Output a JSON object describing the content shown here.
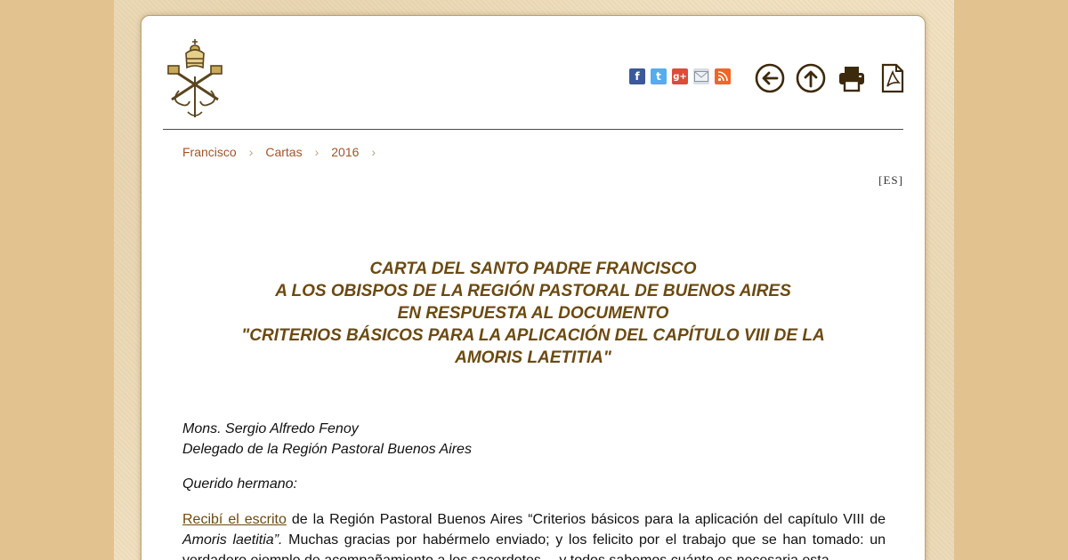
{
  "breadcrumb": [
    "Francisco",
    "Cartas",
    "2016"
  ],
  "language": "[ES]",
  "title_lines": [
    "CARTA DEL SANTO PADRE FRANCISCO",
    "A LOS OBISPOS DE LA REGIÓN PASTORAL DE BUENOS AIRES",
    "EN RESPUESTA AL DOCUMENTO",
    "\"CRITERIOS BÁSICOS PARA LA APLICACIÓN DEL CAPÍTULO VIII DE LA",
    "AMORIS LAETITIA\""
  ],
  "addressee": {
    "name": "Mons. Sergio Alfredo Fenoy",
    "role": "Delegado de la Región Pastoral Buenos Aires"
  },
  "greeting": "Querido hermano:",
  "body": {
    "link": "Recibí el escrito",
    "text1": " de la Región Pastoral Buenos Aires “Criterios básicos para la aplicación del capítulo VIII de ",
    "emph": "Amoris laetitia”.",
    "text2": " Muchas gracias por habérmelo enviado; y los felicito por el trabajo que se han tomado: un verdadero ejemplo de acompañamiento a los sacerdotes… y todos sabemos cuánto es necesaria esta"
  },
  "share_icons": [
    "facebook-icon",
    "twitter-icon",
    "google-plus-icon",
    "email-icon",
    "rss-icon"
  ],
  "tool_icons": [
    "back-icon",
    "top-icon",
    "print-icon",
    "pdf-icon"
  ],
  "colors": {
    "title": "#6b4a12",
    "link": "#a0552a",
    "page_bg": "#e2c28f",
    "parchment": "#f1e2c3",
    "facebook": "#3b5998",
    "twitter": "#55acee",
    "google": "#dd4b39",
    "rss": "#f26522"
  }
}
